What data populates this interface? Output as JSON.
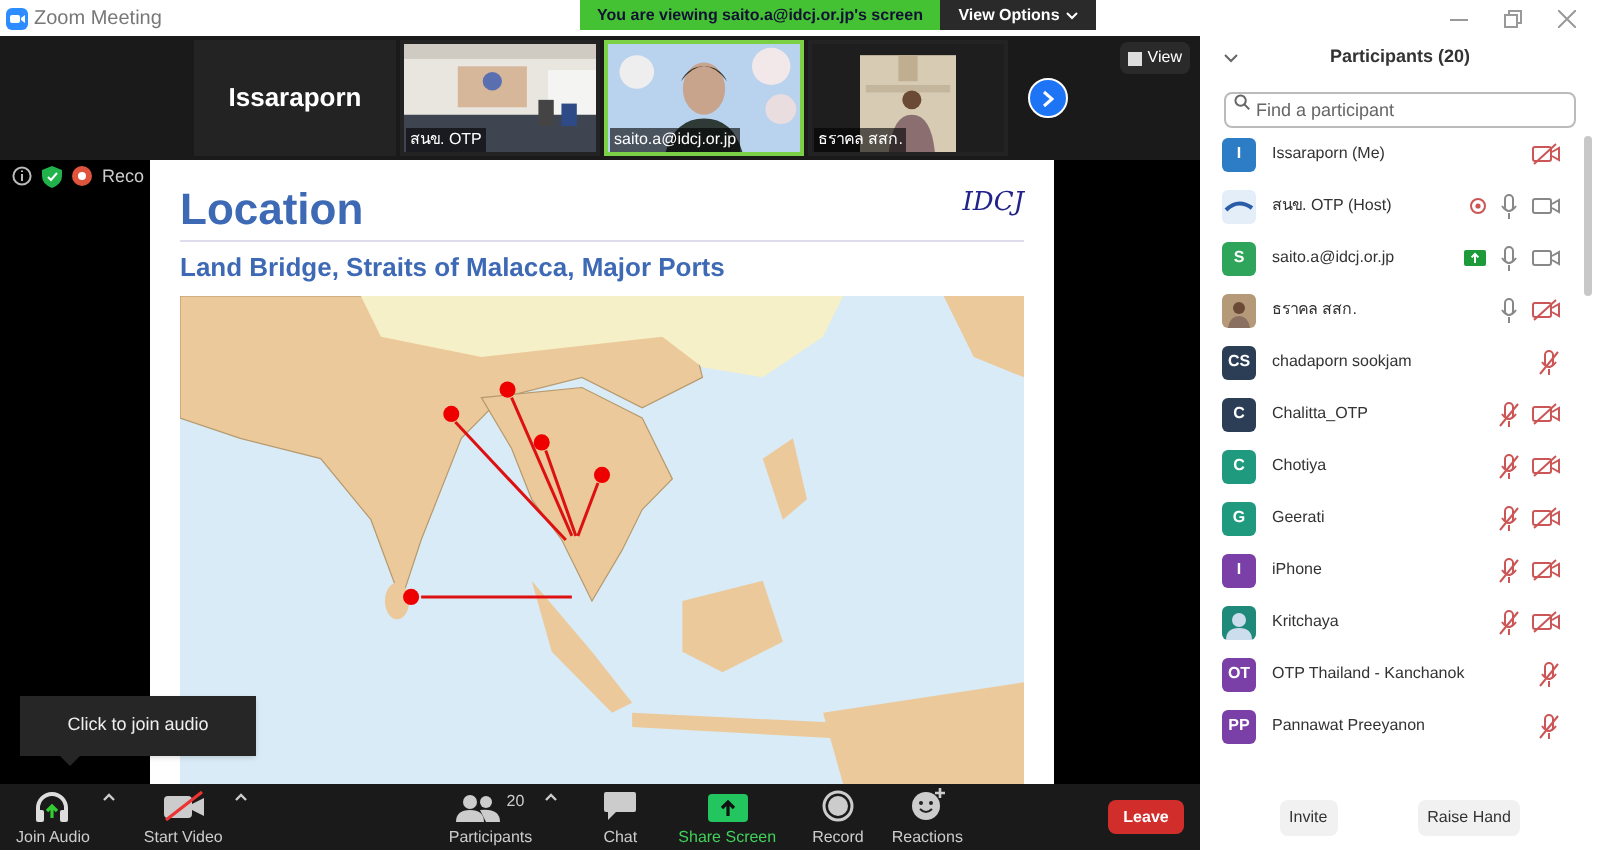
{
  "window": {
    "title": "Zoom Meeting"
  },
  "share_banner": {
    "text": "You are viewing saito.a@idcj.or.jp's screen",
    "view_options": "View Options"
  },
  "video_strip": {
    "tiles": [
      {
        "kind": "name",
        "name": "Issaraporn"
      },
      {
        "kind": "video",
        "name": "สนข. OTP",
        "active": false
      },
      {
        "kind": "video",
        "name": "saito.a@idcj.or.jp",
        "active": true
      },
      {
        "kind": "video",
        "name": "ธราคล สสก.",
        "active": false
      }
    ],
    "view_button": "View"
  },
  "status": {
    "recording_label": "Reco"
  },
  "slide": {
    "title": "Location",
    "logo": "IDCJ",
    "subtitle": "Land Bridge, Straits of Malacca, Major Ports"
  },
  "tooltip": "Click to join audio",
  "toolbar": {
    "items": [
      {
        "kind": "audio",
        "label": "Join Audio",
        "caret": true
      },
      {
        "kind": "video",
        "label": "Start Video",
        "caret": true
      },
      {
        "kind": "participants",
        "label": "Participants",
        "count": "20",
        "caret": true
      },
      {
        "kind": "chat",
        "label": "Chat",
        "caret": false
      },
      {
        "kind": "share",
        "label": "Share Screen",
        "caret": false
      },
      {
        "kind": "record",
        "label": "Record",
        "caret": false
      },
      {
        "kind": "reactions",
        "label": "Reactions",
        "caret": false
      }
    ],
    "leave": "Leave"
  },
  "participants": {
    "title": "Participants (20)",
    "search": {
      "placeholder": "Find a participant"
    },
    "items": [
      {
        "name": "Issaraporn (Me)",
        "avatar": "I",
        "kind": "initials",
        "color": "#2d7dc6",
        "video_off": true
      },
      {
        "name": "สนข. OTP (Host)",
        "kind": "logo",
        "recording": true,
        "mic_muted": false,
        "video_off": false
      },
      {
        "name": "saito.a@idcj.or.jp",
        "avatar": "S",
        "kind": "initials",
        "color": "#2ea55a",
        "sharing": true,
        "mic_muted": false,
        "video_off": false
      },
      {
        "name": "ธราคล สสก.",
        "mic_muted": false,
        "video_off": true
      },
      {
        "name": "chadaporn sookjam",
        "avatar": "CS",
        "kind": "initials",
        "color": "#2c3e55",
        "mic_muted": true
      },
      {
        "name": "Chalitta_OTP",
        "avatar": "C",
        "kind": "initials",
        "color": "#2c3e55",
        "mic_muted": true,
        "video_off": true
      },
      {
        "name": "Chotiya",
        "avatar": "C",
        "kind": "initials",
        "color": "#1f9a7e",
        "mic_muted": true,
        "video_off": true
      },
      {
        "name": "Geerati",
        "avatar": "G",
        "kind": "initials",
        "color": "#1f9a7e",
        "mic_muted": true,
        "video_off": true
      },
      {
        "name": "iPhone",
        "avatar": "I",
        "kind": "initials",
        "color": "#7b3fa8",
        "mic_muted": true,
        "video_off": true
      },
      {
        "name": "Kritchaya",
        "kind": "person",
        "color": "#1f8a7a",
        "mic_muted": true,
        "video_off": true
      },
      {
        "name": "OTP Thailand - Kanchanok",
        "avatar": "OT",
        "kind": "initials",
        "color": "#7b3fa8",
        "mic_muted": true
      },
      {
        "name": "Pannawat Preeyanon",
        "avatar": "PP",
        "kind": "initials",
        "color": "#7b3fa8",
        "mic_muted": true
      }
    ],
    "buttons": [
      "Invite",
      "Raise Hand"
    ]
  }
}
